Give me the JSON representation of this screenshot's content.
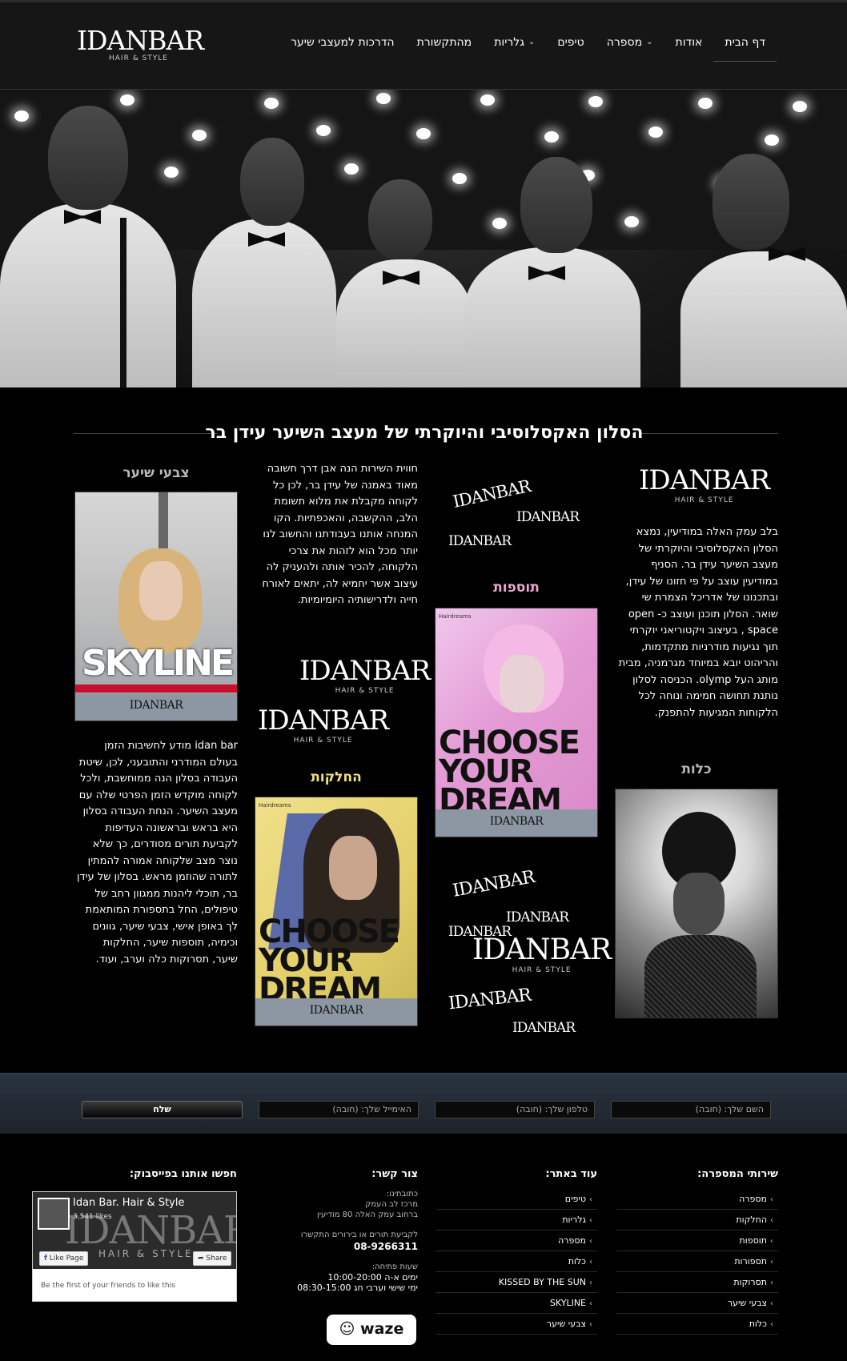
{
  "header": {
    "logo": {
      "main": "IDANBAR",
      "sub": "HAIR & STYLE"
    },
    "nav": [
      {
        "label": "דף הבית",
        "dropdown": false
      },
      {
        "label": "אודות",
        "dropdown": false
      },
      {
        "label": "מספרה",
        "dropdown": true
      },
      {
        "label": "טיפים",
        "dropdown": false
      },
      {
        "label": "גלריות",
        "dropdown": true
      },
      {
        "label": "מהתקשורת",
        "dropdown": false
      },
      {
        "label": "הדרכות למעצבי שיער",
        "dropdown": false
      }
    ]
  },
  "main": {
    "title": "הסלון האקסלוסיבי והיוקרתי של מעצב השיער עידן בר",
    "col_right": {
      "text": "בלב עמק האלה במודיעין, נמצא הסלון האקסלוסיבי והיוקרתי של מעצב השיער עידן בר. הסניף במודיעין עוצב על פי חזונו של עידן, ובתכנונו של אדריכל הצמרת שי שואר. הסלון תוכנן ועוצב כ- open space , בעיצוב ויקטוריאני יוקרתי תוך נגיעות מודרניות מתקדמות, והריהוט יובא במיוחד מגרמניה, מבית מותג העל olymp. הכניסה לסלון נותנת תחושה חמימה ונוחה לכל הלקוחות המגיעות להתפנק.",
      "heading": "כלות"
    },
    "col_mid_right": {
      "heading": "תוספות",
      "poster": {
        "big": "CHOOSE YOUR DREAM",
        "band": "IDANBAR",
        "brand": "Hairdreams"
      }
    },
    "col_mid_left": {
      "text": "חווית השירות הנה אבן דרך חשובה מאוד באמנה של עידן בר, לכן כל לקוחה מקבלת את מלוא תשומת הלב, ההקשבה, והאכפתיות. הקו המנחה אותנו בעבודתנו והחשוב לנו יותר מכל הוא לזהות את צרכי הלקוחה, להכיר אותה ולהעניק לה עיצוב אשר יחמיא לה, יתאים לאורח חייה ולדרישותיה היומיומיות.",
      "heading": "החלקות",
      "poster": {
        "big": "CHOOSE YOUR DREAM",
        "band": "IDANBAR",
        "brand": "Hairdreams"
      }
    },
    "col_left": {
      "heading": "צבעי שיער",
      "poster": {
        "big": "SKYLINE",
        "band": "IDANBAR"
      },
      "text": "idan bar מודע לחשיבות הזמן בעולם המודרני והתובעני, לכן, שיטת העבודה בסלון הנה ממוחשבת, ולכל לקוחה מוקדש הזמן הפרטי שלה עם מעצב השיער. הנחת העבודה בסלון היא בראש ובראשונה העדיפות לקביעת תורים מסודרים, כך שלא נוצר מצב שלקוחה אמורה להמתין לתורה שהוזמן מראש. בסלון של עידן בר, תוכלי ליהנות ממגוון רחב של טיפולים, החל בתספורת המותאמת לך באופן אישי, צבעי שיער, גוונים וכימיה, תוספות שיער, החלקות שיער, תסרוקות כלה וערב, ועוד."
    }
  },
  "form": {
    "name": "השם שלך: (חובה)",
    "phone": "טלפון שלך: (חובה)",
    "email": "האימייל שלך: (חובה)",
    "submit": "שלח"
  },
  "footer": {
    "services": {
      "heading": "שירותי המספרה:",
      "items": [
        "מספרה",
        "החלקות",
        "תוספות",
        "תספורות",
        "תסרוקות",
        "צבעי שיער",
        "כלות"
      ]
    },
    "more": {
      "heading": "עוד באתר:",
      "items": [
        "טיפים",
        "גלריות",
        "מספרה",
        "כלות",
        "KISSED BY THE SUN",
        "SKYLINE",
        "צבעי שיער"
      ]
    },
    "contact": {
      "heading": "צור קשר:",
      "address_label": "כתובתינו:",
      "address_1": "מרכז לב העמק",
      "address_2": "ברחוב עמק האלה 80 מודיעין",
      "call_label": "לקביעת תורים או בירורים התקשרו",
      "phone": "08-9266311",
      "hours_label": "שעות פתיחה:",
      "hours_1": "ימים א-ה 10:00-20:00",
      "hours_2": "ימי שישי וערבי חג 08:30-15:00",
      "waze": "waze"
    },
    "facebook": {
      "heading": "חפשו אותנו בפייסבוק:",
      "page_name": "Idan Bar. Hair & Style",
      "likes": "3,541 likes",
      "like_btn": "Like Page",
      "share_btn": "Share",
      "footnote": "Be the first of your friends to like this",
      "cover_main": "IDANBAR",
      "cover_sub": "HAIR & STYLE"
    }
  },
  "colors": {
    "accent_pink": "#f2a6d8",
    "accent_yellow": "#f2e27a",
    "heading_gray": "#b9b9b9"
  }
}
